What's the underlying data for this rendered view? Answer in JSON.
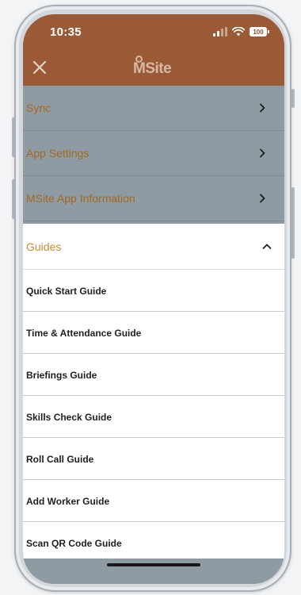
{
  "status_bar": {
    "time": "10:35",
    "battery": "100"
  },
  "header": {
    "logo_text": "MSite",
    "accent_color": "#9a5a35"
  },
  "menu": {
    "items": [
      {
        "label": "Sync"
      },
      {
        "label": "App Settings"
      },
      {
        "label": "MSite App Information"
      }
    ]
  },
  "guides": {
    "title": "Guides",
    "expanded": true,
    "items": [
      {
        "label": "Quick Start Guide"
      },
      {
        "label": "Time & Attendance Guide"
      },
      {
        "label": "Briefings Guide"
      },
      {
        "label": "Skills Check Guide"
      },
      {
        "label": "Roll Call Guide"
      },
      {
        "label": "Add Worker Guide"
      },
      {
        "label": "Scan QR Code Guide"
      }
    ]
  },
  "icons": {
    "close": "close-icon",
    "chevron_right": "chevron-right-icon",
    "chevron_up": "chevron-up-icon",
    "signal": "signal-icon",
    "wifi": "wifi-icon",
    "battery": "battery-icon"
  }
}
